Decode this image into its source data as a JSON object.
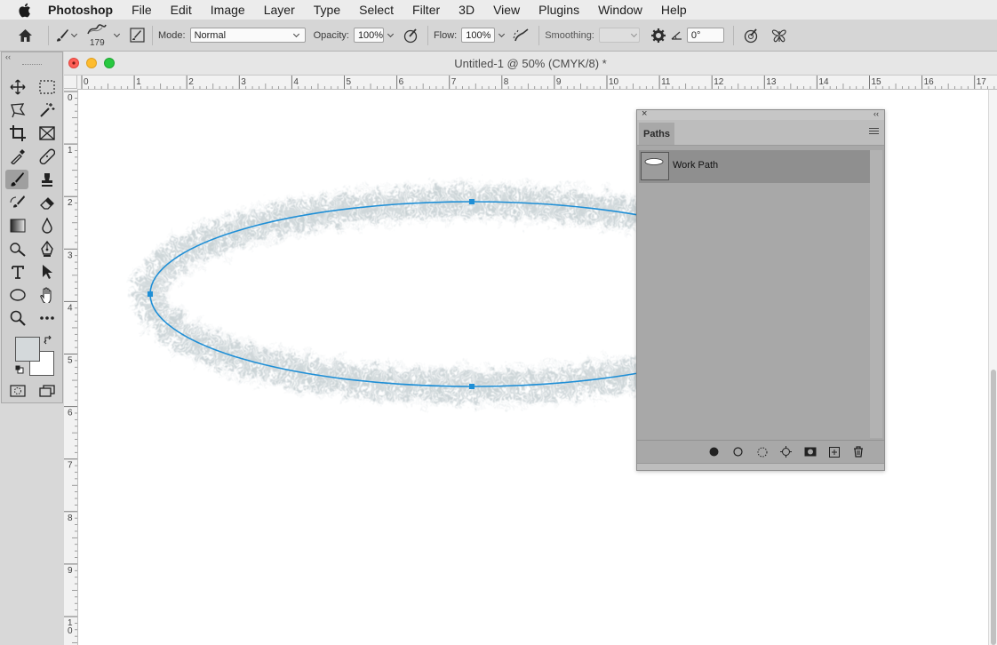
{
  "menubar": {
    "app_name": "Photoshop",
    "items": [
      "File",
      "Edit",
      "Image",
      "Layer",
      "Type",
      "Select",
      "Filter",
      "3D",
      "View",
      "Plugins",
      "Window",
      "Help"
    ]
  },
  "options": {
    "brush_size": "179",
    "mode_label": "Mode:",
    "mode_value": "Normal",
    "opacity_label": "Opacity:",
    "opacity_value": "100%",
    "flow_label": "Flow:",
    "flow_value": "100%",
    "smoothing_label": "Smoothing:",
    "smoothing_value": "",
    "angle_value": "0°"
  },
  "document": {
    "title": "Untitled-1 @ 50% (CMYK/8) *",
    "h_ruler": [
      "0",
      "1",
      "2",
      "3",
      "4",
      "5",
      "6",
      "7",
      "8",
      "9",
      "10",
      "11",
      "12",
      "13",
      "14",
      "15",
      "16",
      "17"
    ],
    "v_ruler": [
      "0",
      "1",
      "2",
      "3",
      "4",
      "5",
      "6",
      "7",
      "8",
      "9",
      "10"
    ]
  },
  "paths_panel": {
    "tab": "Paths",
    "rows": [
      {
        "name": "Work Path"
      }
    ]
  },
  "colors": {
    "path_stroke": "#1f8fd6",
    "brush_tint": "#cdd5d8",
    "foreground": "#d4d9db",
    "background": "#ffffff"
  },
  "icons": {
    "apple": "apple-icon",
    "home": "home-icon",
    "brush": "brush-icon"
  }
}
